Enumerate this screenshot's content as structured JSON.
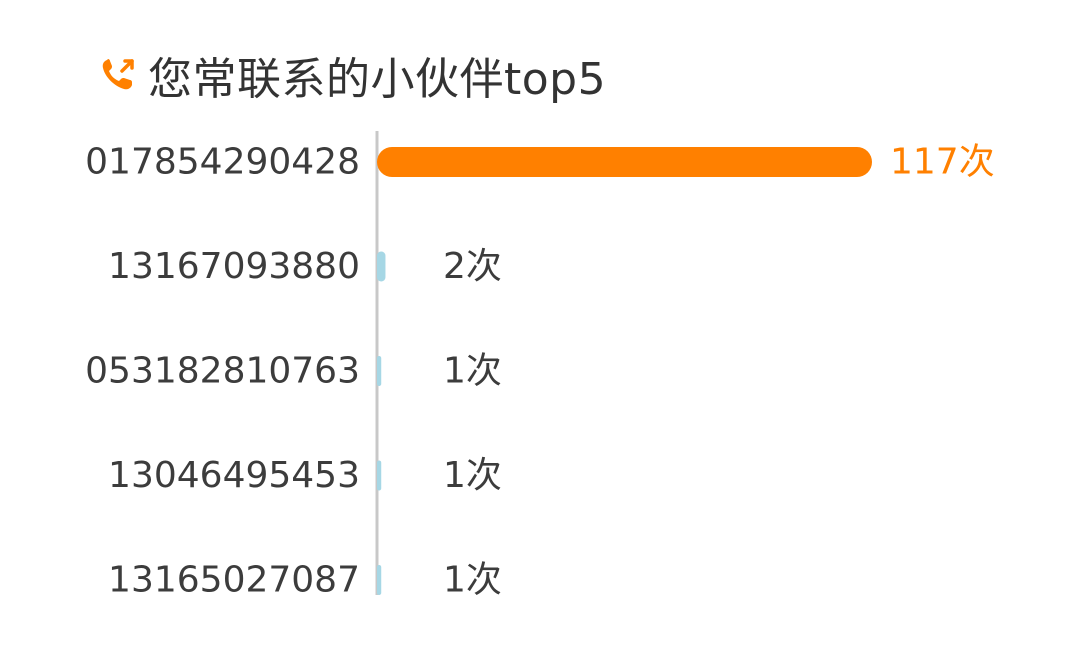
{
  "header": {
    "title": "您常联系的小伙伴top5",
    "icon": "phone-callout-icon"
  },
  "colors": {
    "highlight": "#ff8000",
    "bar": "#a6d7e5",
    "label": "#3c3c3c",
    "axis": "#c8c8c8"
  },
  "chart_data": {
    "type": "bar",
    "orientation": "horizontal",
    "title": "您常联系的小伙伴top5",
    "categories": [
      "017854290428",
      "13167093880",
      "053182810763",
      "13046495453",
      "13165027087"
    ],
    "values": [
      117,
      2,
      1,
      1,
      1
    ],
    "value_labels": [
      "117次",
      "2次",
      "1次",
      "1次",
      "1次"
    ],
    "xlim": [
      0,
      117
    ],
    "highlight_index": 0,
    "grid": false,
    "legend": "none"
  }
}
